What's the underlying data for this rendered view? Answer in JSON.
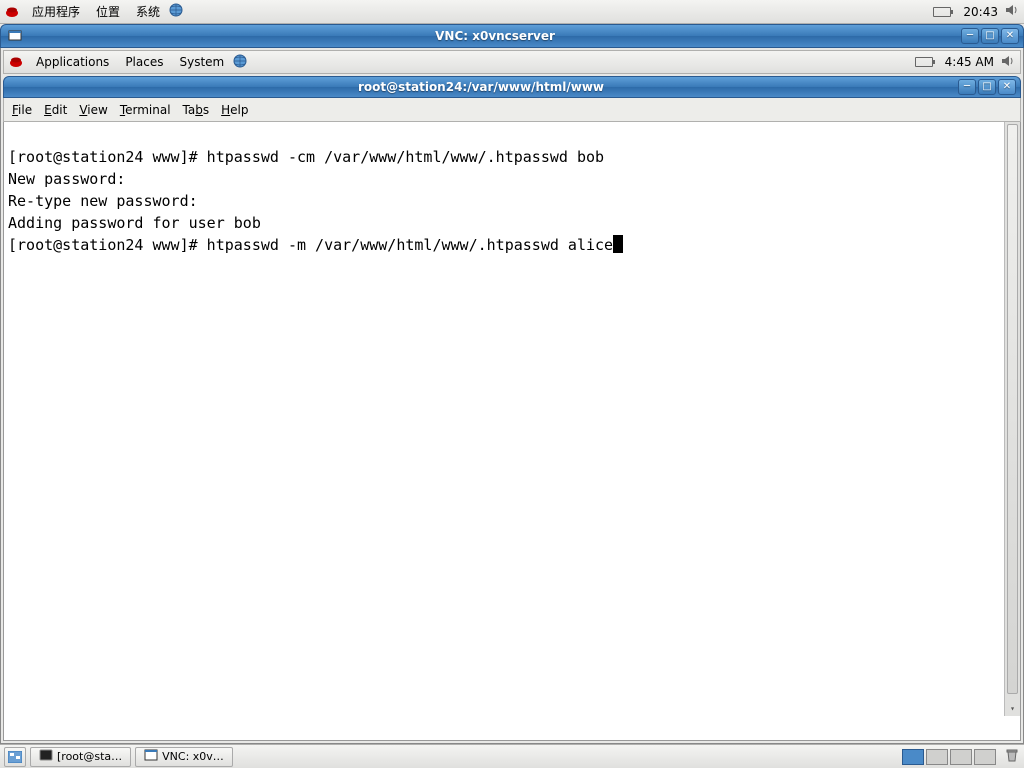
{
  "outer_panel": {
    "menu_applications": "应用程序",
    "menu_places": "位置",
    "menu_system": "系统",
    "clock": "20:43"
  },
  "vnc_window": {
    "title": "VNC: x0vncserver"
  },
  "inner_panel": {
    "menu_applications": "Applications",
    "menu_places": "Places",
    "menu_system": "System",
    "clock": "4:45 AM"
  },
  "terminal_window": {
    "title": "root@station24:/var/www/html/www",
    "menu": {
      "file": "File",
      "edit": "Edit",
      "view": "View",
      "terminal": "Terminal",
      "tabs": "Tabs",
      "help": "Help"
    },
    "lines": [
      "[root@station24 www]# htpasswd -cm /var/www/html/www/.htpasswd bob",
      "New password: ",
      "Re-type new password: ",
      "Adding password for user bob",
      "[root@station24 www]# htpasswd -m /var/www/html/www/.htpasswd alice"
    ]
  },
  "taskbar": {
    "task1": "[root@sta…",
    "task2": "VNC: x0v…"
  }
}
